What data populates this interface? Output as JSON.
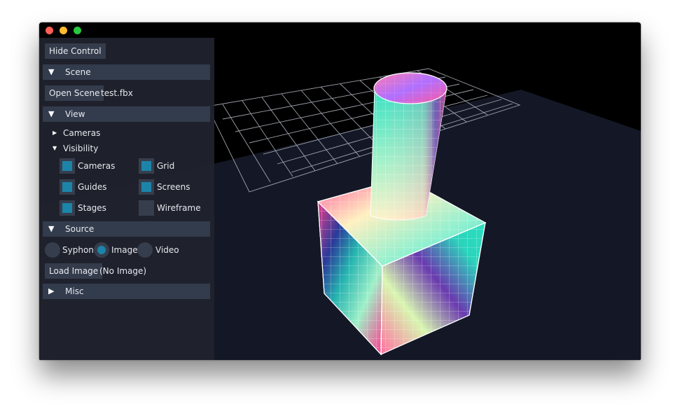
{
  "window": {
    "controls": [
      "close",
      "minimize",
      "maximize"
    ]
  },
  "panel": {
    "hide_control_label": "Hide Control",
    "scene": {
      "header": "Scene",
      "open_scene_label": "Open Scene",
      "file_name": "test.fbx"
    },
    "view": {
      "header": "View",
      "cameras_node": "Cameras",
      "visibility_node": "Visibility",
      "visibility": {
        "cameras": {
          "label": "Cameras",
          "checked": true
        },
        "grid": {
          "label": "Grid",
          "checked": true
        },
        "guides": {
          "label": "Guides",
          "checked": true
        },
        "screens": {
          "label": "Screens",
          "checked": true
        },
        "stages": {
          "label": "Stages",
          "checked": true
        },
        "wireframe": {
          "label": "Wireframe",
          "checked": false
        }
      }
    },
    "source": {
      "header": "Source",
      "options": [
        "Syphon",
        "Image",
        "Video"
      ],
      "selected": "Image",
      "load_image_label": "Load Image",
      "image_status": "(No Image)"
    },
    "misc": {
      "header": "Misc"
    }
  },
  "colors": {
    "accent": "#1c84a8",
    "panel_bg": "#20242e",
    "header_bg": "#333c4d",
    "floor": "#141826"
  }
}
